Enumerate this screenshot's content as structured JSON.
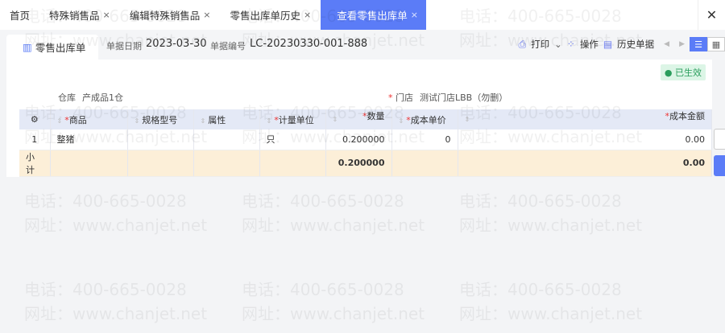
{
  "tabs": [
    {
      "label": "首页",
      "closable": false
    },
    {
      "label": "特殊销售品",
      "closable": true
    },
    {
      "label": "编辑特殊销售品",
      "closable": true
    },
    {
      "label": "零售出库单历史",
      "closable": true
    },
    {
      "label": "查看零售出库单",
      "closable": true,
      "active": true
    }
  ],
  "close_symbol": "×",
  "toolbar": {
    "doc_tab": "零售出库单",
    "date_label": "单据日期",
    "date": "2023-03-30",
    "no_label": "单据编号",
    "no": "LC-20230330-001-888",
    "print": "打印",
    "operate": "操作",
    "history": "历史单据"
  },
  "status": "已生效",
  "fields": {
    "warehouse_label": "仓库",
    "warehouse": "产成品1仓",
    "store_label": "门店",
    "store": "测试门店LBB（勿删）"
  },
  "table": {
    "headers": [
      "商品",
      "规格型号",
      "属性",
      "计量单位",
      "数量",
      "成本单价",
      "成本金额"
    ],
    "rows": [
      {
        "no": "1",
        "product": "整猪",
        "spec": "",
        "attr": "",
        "unit": "只",
        "qty": "0.200000",
        "price": "0",
        "amount": "0.00"
      }
    ],
    "subtotal": {
      "label": "小计",
      "qty": "0.200000",
      "amount": "0.00"
    }
  },
  "watermark": [
    "电话：400-665-0028",
    "网址：www.chanjet.net"
  ],
  "colors": {
    "accent": "#5b7cf7",
    "status": "#2a9d5c",
    "subtotal_bg": "#fcefd8"
  }
}
